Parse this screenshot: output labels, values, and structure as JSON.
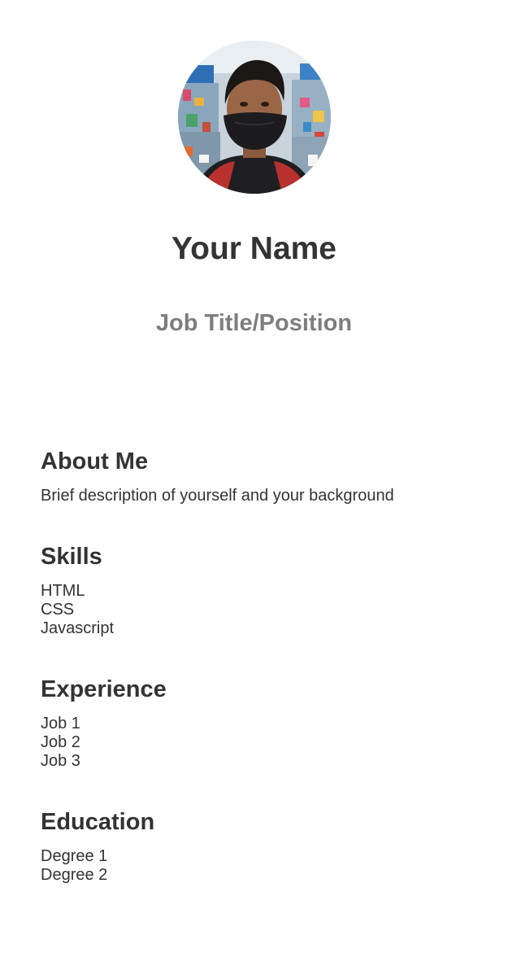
{
  "profile": {
    "name": "Your Name",
    "job_title": "Job Title/Position"
  },
  "sections": {
    "about": {
      "heading": "About Me",
      "text": "Brief description of yourself and your background"
    },
    "skills": {
      "heading": "Skills",
      "items": [
        "HTML",
        "CSS",
        "Javascript"
      ]
    },
    "experience": {
      "heading": "Experience",
      "items": [
        "Job 1",
        "Job 2",
        "Job 3"
      ]
    },
    "education": {
      "heading": "Education",
      "items": [
        "Degree 1",
        "Degree 2"
      ]
    }
  },
  "colors": {
    "text": "#333333",
    "subtitle": "#7e7e7e",
    "background": "#ffffff"
  }
}
